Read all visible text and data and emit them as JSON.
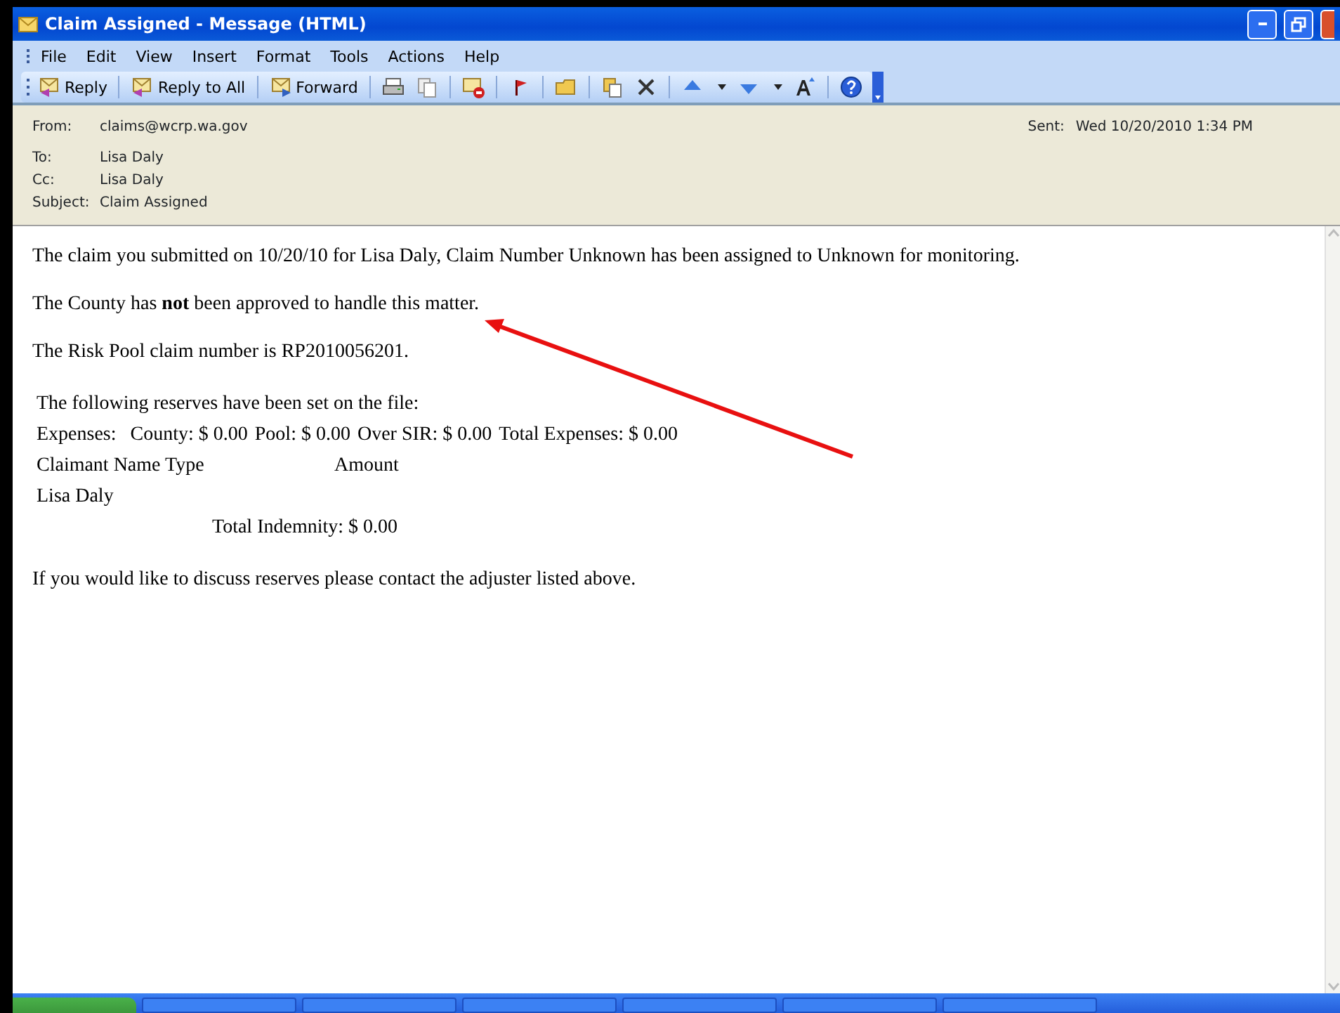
{
  "window": {
    "title": "Claim Assigned - Message (HTML)"
  },
  "menu": [
    "File",
    "Edit",
    "View",
    "Insert",
    "Format",
    "Tools",
    "Actions",
    "Help"
  ],
  "toolbar": {
    "buttons": [
      {
        "label": "Reply"
      },
      {
        "label": "Reply to All"
      },
      {
        "label": "Forward"
      }
    ]
  },
  "header": {
    "from_label": "From:",
    "from": "claims@wcrp.wa.gov",
    "sent_label": "Sent:",
    "sent": "Wed 10/20/2010 1:34 PM",
    "fields": [
      {
        "label": "To:",
        "value": "Lisa Daly"
      },
      {
        "label": "Cc:",
        "value": "Lisa Daly"
      },
      {
        "label": "Subject:",
        "value": "Claim Assigned"
      }
    ]
  },
  "body": {
    "paragraphs": [
      "The claim you submitted on 10/20/10 for Lisa Daly, Claim Number Unknown has been assigned to Unknown for monitoring.",
      "The County has **not** been approved to handle this matter.",
      "The Risk Pool claim number is RP2010056201."
    ],
    "reserves_intro": "The following reserves have been set on the file:",
    "expenses": [
      "Expenses:",
      "County: $ 0.00",
      "Pool: $ 0.00",
      "Over SIR: $ 0.00",
      "Total Expenses: $ 0.00"
    ],
    "claimant_columns": [
      "Claimant Name Type",
      "Amount"
    ],
    "claimant_rows": [
      "Lisa Daly"
    ],
    "total_indemnity": "Total Indemnity: $ 0.00",
    "closing": "If you would like to discuss reserves please contact the adjuster listed above."
  }
}
